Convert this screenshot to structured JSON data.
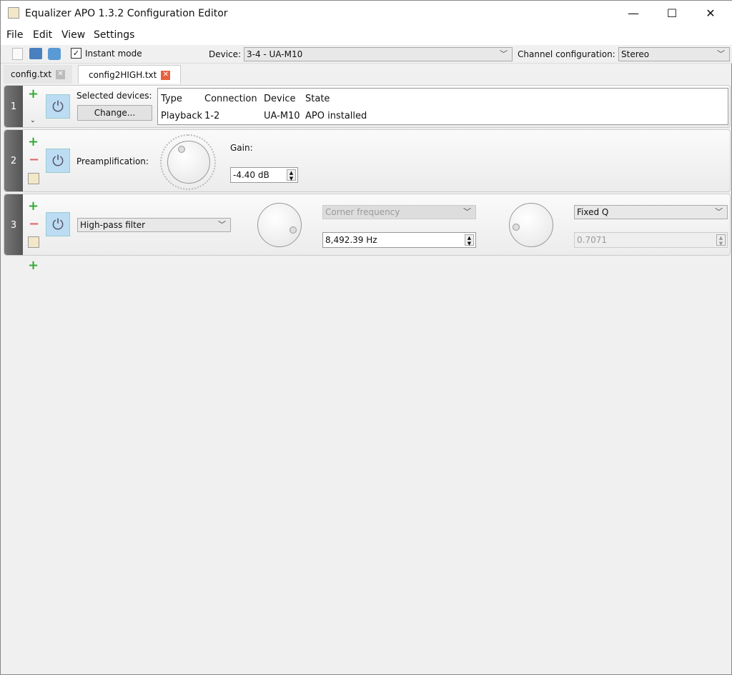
{
  "window": {
    "title": "Equalizer APO 1.3.2 Configuration Editor",
    "minimize": "—",
    "maximize": "☐",
    "close": "✕"
  },
  "menu": [
    "File",
    "Edit",
    "View",
    "Settings"
  ],
  "toolbar": {
    "instant_mode": "Instant mode",
    "instant_checked": true,
    "device_label": "Device:",
    "device_value": "3-4 - UA-M10",
    "channel_label": "Channel configuration:",
    "channel_value": "Stereo"
  },
  "tabs": [
    {
      "label": "config.txt",
      "active": false
    },
    {
      "label": "config2HIGH.txt",
      "active": true
    }
  ],
  "panel1": {
    "number": "1",
    "selected_label": "Selected devices:",
    "change_button": "Change...",
    "table": {
      "headers": [
        "Type",
        "Connection",
        "Device",
        "State"
      ],
      "rows": [
        [
          "Playback",
          "1-2",
          "UA-M10",
          "APO installed"
        ]
      ]
    }
  },
  "panel2": {
    "number": "2",
    "label": "Preamplification:",
    "gain_label": "Gain:",
    "gain_value": "-4.40 dB"
  },
  "panel3": {
    "number": "3",
    "filter_type": "High-pass filter",
    "freq_mode": "Corner frequency",
    "freq_value": "8,492.39 Hz",
    "q_mode": "Fixed Q",
    "q_value": "0.7071"
  }
}
